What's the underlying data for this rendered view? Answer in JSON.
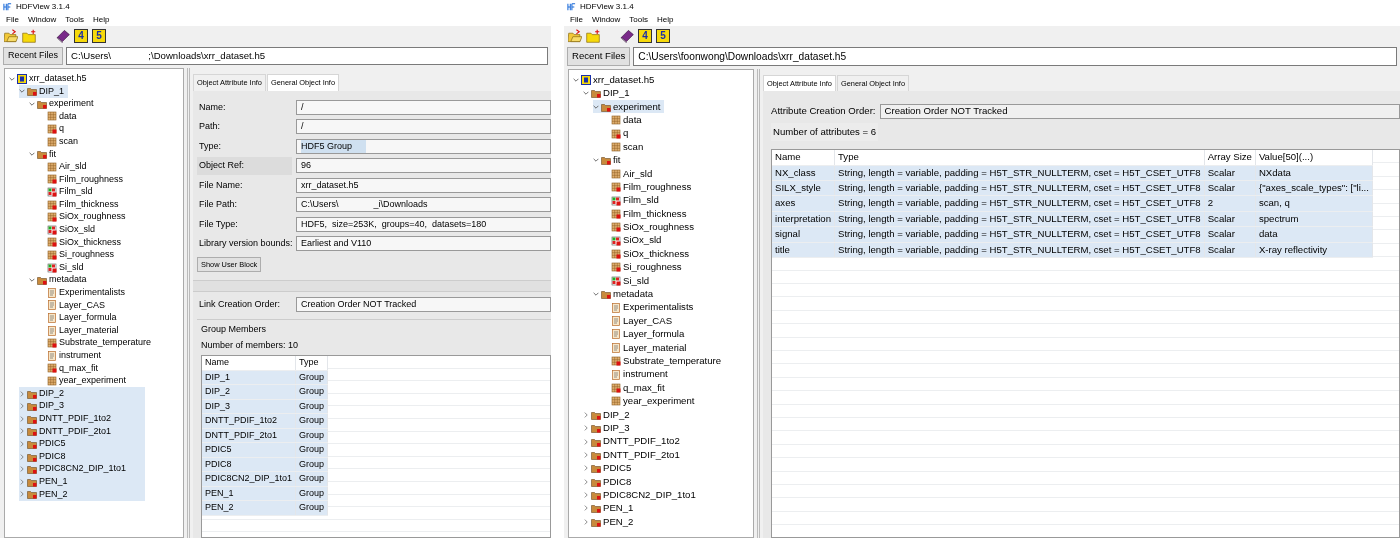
{
  "windows": [
    {
      "title": "HDFView 3.1.4",
      "menu": [
        "File",
        "Window",
        "Tools",
        "Help"
      ],
      "toolbar": [
        {
          "kind": "open"
        },
        {
          "kind": "new"
        },
        {
          "kind": "help"
        },
        {
          "kind": "hdf4",
          "label": "4"
        },
        {
          "kind": "hdf5",
          "label": "5"
        }
      ],
      "recent_files": "Recent Files",
      "path": "C:\\Users\\              ;\\Downloads\\xrr_dataset.h5",
      "tree": [
        {
          "label": "xrr_dataset.h5",
          "kind": "file",
          "expanded": true,
          "selected": false,
          "children": [
            {
              "label": "DIP_1",
              "kind": "group",
              "expanded": true,
              "selected": true,
              "children": [
                {
                  "label": "experiment",
                  "kind": "group",
                  "expanded": true,
                  "selected": false,
                  "children": [
                    {
                      "label": "data",
                      "kind": "dataset",
                      "selected": false
                    },
                    {
                      "label": "q",
                      "kind": "dataset_attr",
                      "selected": false
                    },
                    {
                      "label": "scan",
                      "kind": "dataset",
                      "selected": false
                    }
                  ]
                },
                {
                  "label": "fit",
                  "kind": "group",
                  "expanded": true,
                  "selected": false,
                  "children": [
                    {
                      "label": "Air_sld",
                      "kind": "dataset",
                      "selected": false
                    },
                    {
                      "label": "Film_roughness",
                      "kind": "dataset_attr",
                      "selected": false
                    },
                    {
                      "label": "Film_sld",
                      "kind": "image",
                      "selected": false
                    },
                    {
                      "label": "Film_thickness",
                      "kind": "dataset_attr",
                      "selected": false
                    },
                    {
                      "label": "SiOx_roughness",
                      "kind": "dataset_attr",
                      "selected": false
                    },
                    {
                      "label": "SiOx_sld",
                      "kind": "image",
                      "selected": false
                    },
                    {
                      "label": "SiOx_thickness",
                      "kind": "dataset_attr",
                      "selected": false
                    },
                    {
                      "label": "Si_roughness",
                      "kind": "dataset_attr",
                      "selected": false
                    },
                    {
                      "label": "Si_sld",
                      "kind": "image",
                      "selected": false
                    }
                  ]
                },
                {
                  "label": "metadata",
                  "kind": "group",
                  "expanded": true,
                  "selected": false,
                  "children": [
                    {
                      "label": "Experimentalists",
                      "kind": "text",
                      "selected": false
                    },
                    {
                      "label": "Layer_CAS",
                      "kind": "text",
                      "selected": false
                    },
                    {
                      "label": "Layer_formula",
                      "kind": "text",
                      "selected": false
                    },
                    {
                      "label": "Layer_material",
                      "kind": "text",
                      "selected": false
                    },
                    {
                      "label": "Substrate_temperature",
                      "kind": "dataset_attr",
                      "selected": false
                    },
                    {
                      "label": "instrument",
                      "kind": "text",
                      "selected": false
                    },
                    {
                      "label": "q_max_fit",
                      "kind": "dataset_attr",
                      "selected": false
                    },
                    {
                      "label": "year_experiment",
                      "kind": "dataset",
                      "selected": false
                    }
                  ]
                }
              ]
            },
            {
              "label": "DIP_2",
              "kind": "group",
              "expanded": false,
              "selected": true
            },
            {
              "label": "DIP_3",
              "kind": "group",
              "expanded": false,
              "selected": true
            },
            {
              "label": "DNTT_PDIF_1to2",
              "kind": "group",
              "expanded": false,
              "selected": true
            },
            {
              "label": "DNTT_PDIF_2to1",
              "kind": "group",
              "expanded": false,
              "selected": true
            },
            {
              "label": "PDIC5",
              "kind": "group",
              "expanded": false,
              "selected": true
            },
            {
              "label": "PDIC8",
              "kind": "group",
              "expanded": false,
              "selected": true
            },
            {
              "label": "PDIC8CN2_DIP_1to1",
              "kind": "group",
              "expanded": false,
              "selected": true
            },
            {
              "label": "PEN_1",
              "kind": "group",
              "expanded": false,
              "selected": true
            },
            {
              "label": "PEN_2",
              "kind": "group",
              "expanded": false,
              "selected": true
            }
          ]
        }
      ],
      "tabs": [
        {
          "label": "Object Attribute Info",
          "selected": false
        },
        {
          "label": "General Object Info",
          "selected": true
        }
      ],
      "panel": {
        "kind": "general",
        "fields": [
          {
            "label": "Name:",
            "value": "/"
          },
          {
            "label": "Path:",
            "value": "/"
          },
          {
            "label": "Type:",
            "value": "HDF5 Group"
          },
          {
            "label": "Object Ref:",
            "value": "96"
          },
          {
            "label": "File Name:",
            "value": "xrr_dataset.h5"
          },
          {
            "label": "File Path:",
            "value": "C:\\Users\\              _i\\Downloads"
          },
          {
            "label": "File Type:",
            "value": "HDF5,  size=253K,  groups=40,  datasets=180"
          },
          {
            "label": "Library version bounds:",
            "value": "Earliest and V110"
          }
        ],
        "user_block_button": "Show User Block",
        "order_label": "Link Creation Order:",
        "order_value": "Creation Order NOT Tracked",
        "group_title": "Group Members",
        "count": "Number of members: 10",
        "columns": [
          "Name",
          "Type"
        ],
        "rows": [
          {
            "cells": [
              "DIP_1",
              "Group"
            ],
            "selected": true
          },
          {
            "cells": [
              "DIP_2",
              "Group"
            ],
            "selected": true
          },
          {
            "cells": [
              "DIP_3",
              "Group"
            ],
            "selected": true
          },
          {
            "cells": [
              "DNTT_PDIF_1to2",
              "Group"
            ],
            "selected": true
          },
          {
            "cells": [
              "DNTT_PDIF_2to1",
              "Group"
            ],
            "selected": true
          },
          {
            "cells": [
              "PDIC5",
              "Group"
            ],
            "selected": true
          },
          {
            "cells": [
              "PDIC8",
              "Group"
            ],
            "selected": true
          },
          {
            "cells": [
              "PDIC8CN2_DIP_1to1",
              "Group"
            ],
            "selected": true
          },
          {
            "cells": [
              "PEN_1",
              "Group"
            ],
            "selected": true
          },
          {
            "cells": [
              "PEN_2",
              "Group"
            ],
            "selected": true
          }
        ]
      }
    },
    {
      "title": "HDFView 3.1.4",
      "menu": [
        "File",
        "Window",
        "Tools",
        "Help"
      ],
      "toolbar": [
        {
          "kind": "open"
        },
        {
          "kind": "new"
        },
        {
          "kind": "help"
        },
        {
          "kind": "hdf4",
          "label": "4"
        },
        {
          "kind": "hdf5",
          "label": "5"
        }
      ],
      "recent_files": "Recent Files",
      "path": "C:\\Users\\foonwong\\Downloads\\xrr_dataset.h5",
      "tree": [
        {
          "label": "xrr_dataset.h5",
          "kind": "file",
          "expanded": true,
          "selected": false,
          "children": [
            {
              "label": "DIP_1",
              "kind": "group",
              "expanded": true,
              "selected": false,
              "children": [
                {
                  "label": "experiment",
                  "kind": "group",
                  "expanded": true,
                  "selected": true,
                  "children": [
                    {
                      "label": "data",
                      "kind": "dataset",
                      "selected": false
                    },
                    {
                      "label": "q",
                      "kind": "dataset_attr",
                      "selected": false
                    },
                    {
                      "label": "scan",
                      "kind": "dataset",
                      "selected": false
                    }
                  ]
                },
                {
                  "label": "fit",
                  "kind": "group",
                  "expanded": true,
                  "selected": false,
                  "children": [
                    {
                      "label": "Air_sld",
                      "kind": "dataset",
                      "selected": false
                    },
                    {
                      "label": "Film_roughness",
                      "kind": "dataset_attr",
                      "selected": false
                    },
                    {
                      "label": "Film_sld",
                      "kind": "image",
                      "selected": false
                    },
                    {
                      "label": "Film_thickness",
                      "kind": "dataset_attr",
                      "selected": false
                    },
                    {
                      "label": "SiOx_roughness",
                      "kind": "dataset_attr",
                      "selected": false
                    },
                    {
                      "label": "SiOx_sld",
                      "kind": "image",
                      "selected": false
                    },
                    {
                      "label": "SiOx_thickness",
                      "kind": "dataset_attr",
                      "selected": false
                    },
                    {
                      "label": "Si_roughness",
                      "kind": "dataset_attr",
                      "selected": false
                    },
                    {
                      "label": "Si_sld",
                      "kind": "image",
                      "selected": false
                    }
                  ]
                },
                {
                  "label": "metadata",
                  "kind": "group",
                  "expanded": true,
                  "selected": false,
                  "children": [
                    {
                      "label": "Experimentalists",
                      "kind": "text",
                      "selected": false
                    },
                    {
                      "label": "Layer_CAS",
                      "kind": "text",
                      "selected": false
                    },
                    {
                      "label": "Layer_formula",
                      "kind": "text",
                      "selected": false
                    },
                    {
                      "label": "Layer_material",
                      "kind": "text",
                      "selected": false
                    },
                    {
                      "label": "Substrate_temperature",
                      "kind": "dataset_attr",
                      "selected": false
                    },
                    {
                      "label": "instrument",
                      "kind": "text",
                      "selected": false
                    },
                    {
                      "label": "q_max_fit",
                      "kind": "dataset_attr",
                      "selected": false
                    },
                    {
                      "label": "year_experiment",
                      "kind": "dataset",
                      "selected": false
                    }
                  ]
                }
              ]
            },
            {
              "label": "DIP_2",
              "kind": "group",
              "expanded": false,
              "selected": false
            },
            {
              "label": "DIP_3",
              "kind": "group",
              "expanded": false,
              "selected": false
            },
            {
              "label": "DNTT_PDIF_1to2",
              "kind": "group",
              "expanded": false,
              "selected": false
            },
            {
              "label": "DNTT_PDIF_2to1",
              "kind": "group",
              "expanded": false,
              "selected": false
            },
            {
              "label": "PDIC5",
              "kind": "group",
              "expanded": false,
              "selected": false
            },
            {
              "label": "PDIC8",
              "kind": "group",
              "expanded": false,
              "selected": false
            },
            {
              "label": "PDIC8CN2_DIP_1to1",
              "kind": "group",
              "expanded": false,
              "selected": false
            },
            {
              "label": "PEN_1",
              "kind": "group",
              "expanded": false,
              "selected": false
            },
            {
              "label": "PEN_2",
              "kind": "group",
              "expanded": false,
              "selected": false
            }
          ]
        }
      ],
      "tabs": [
        {
          "label": "Object Attribute Info",
          "selected": true
        },
        {
          "label": "General Object Info",
          "selected": false
        }
      ],
      "panel": {
        "kind": "attributes",
        "order_label": "Attribute Creation Order:",
        "order_value": "Creation Order NOT Tracked",
        "count": "Number of attributes = 6",
        "columns": [
          "Name",
          "Type",
          "Array Size",
          "Value[50](...)"
        ],
        "rows": [
          {
            "cells": [
              "NX_class",
              "String, length = variable, padding = H5T_STR_NULLTERM, cset = H5T_CSET_UTF8",
              "Scalar",
              "NXdata"
            ],
            "selected": true
          },
          {
            "cells": [
              "SILX_style",
              "String, length = variable, padding = H5T_STR_NULLTERM, cset = H5T_CSET_UTF8",
              "Scalar",
              "{\"axes_scale_types\": [\"li..."
            ],
            "selected": true
          },
          {
            "cells": [
              "axes",
              "String, length = variable, padding = H5T_STR_NULLTERM, cset = H5T_CSET_UTF8",
              "2",
              "scan, q"
            ],
            "selected": true
          },
          {
            "cells": [
              "interpretation",
              "String, length = variable, padding = H5T_STR_NULLTERM, cset = H5T_CSET_UTF8",
              "Scalar",
              "spectrum"
            ],
            "selected": true
          },
          {
            "cells": [
              "signal",
              "String, length = variable, padding = H5T_STR_NULLTERM, cset = H5T_CSET_UTF8",
              "Scalar",
              "data"
            ],
            "selected": true
          },
          {
            "cells": [
              "title",
              "String, length = variable, padding = H5T_STR_NULLTERM, cset = H5T_CSET_UTF8",
              "Scalar",
              "X-ray reflectivity"
            ],
            "selected": true
          }
        ]
      }
    }
  ]
}
